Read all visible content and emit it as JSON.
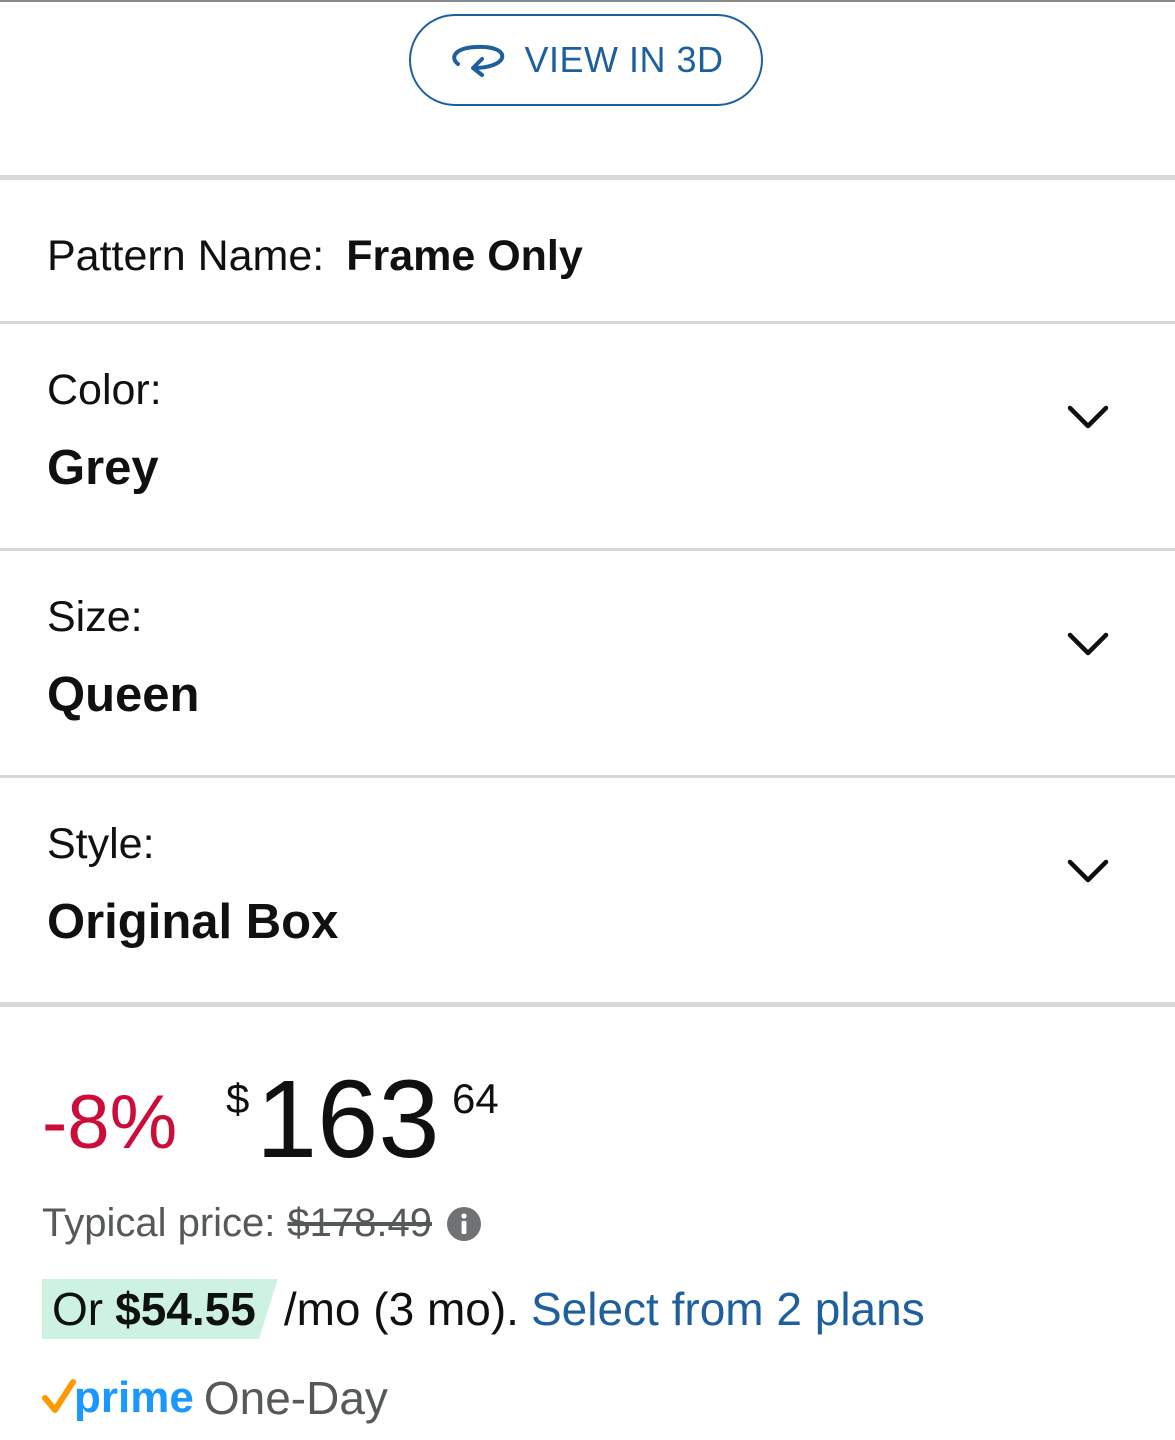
{
  "view_3d": {
    "label": "VIEW IN 3D",
    "icon": "rotate-3d-icon"
  },
  "pattern": {
    "label": "Pattern Name:",
    "value": "Frame Only"
  },
  "variations": [
    {
      "label": "Color:",
      "value": "Grey"
    },
    {
      "label": "Size:",
      "value": "Queen"
    },
    {
      "label": "Style:",
      "value": "Original Box"
    }
  ],
  "price": {
    "discount": "-8%",
    "currency": "$",
    "whole": "163",
    "fraction": "64",
    "typical_label": "Typical price:",
    "typical_value": "$178.49"
  },
  "installments": {
    "prefix": "Or",
    "amount": "$54.55",
    "terms": "/mo (3 mo).",
    "link": "Select from 2 plans"
  },
  "prime": {
    "logo_text": "prime",
    "delivery": "One-Day"
  },
  "colors": {
    "accent_blue": "#1e5f9e",
    "discount_red": "#cc0c39",
    "installment_bg": "#cdf2e1",
    "prime_blue": "#1a98ff",
    "prime_check": "#ff9900"
  }
}
